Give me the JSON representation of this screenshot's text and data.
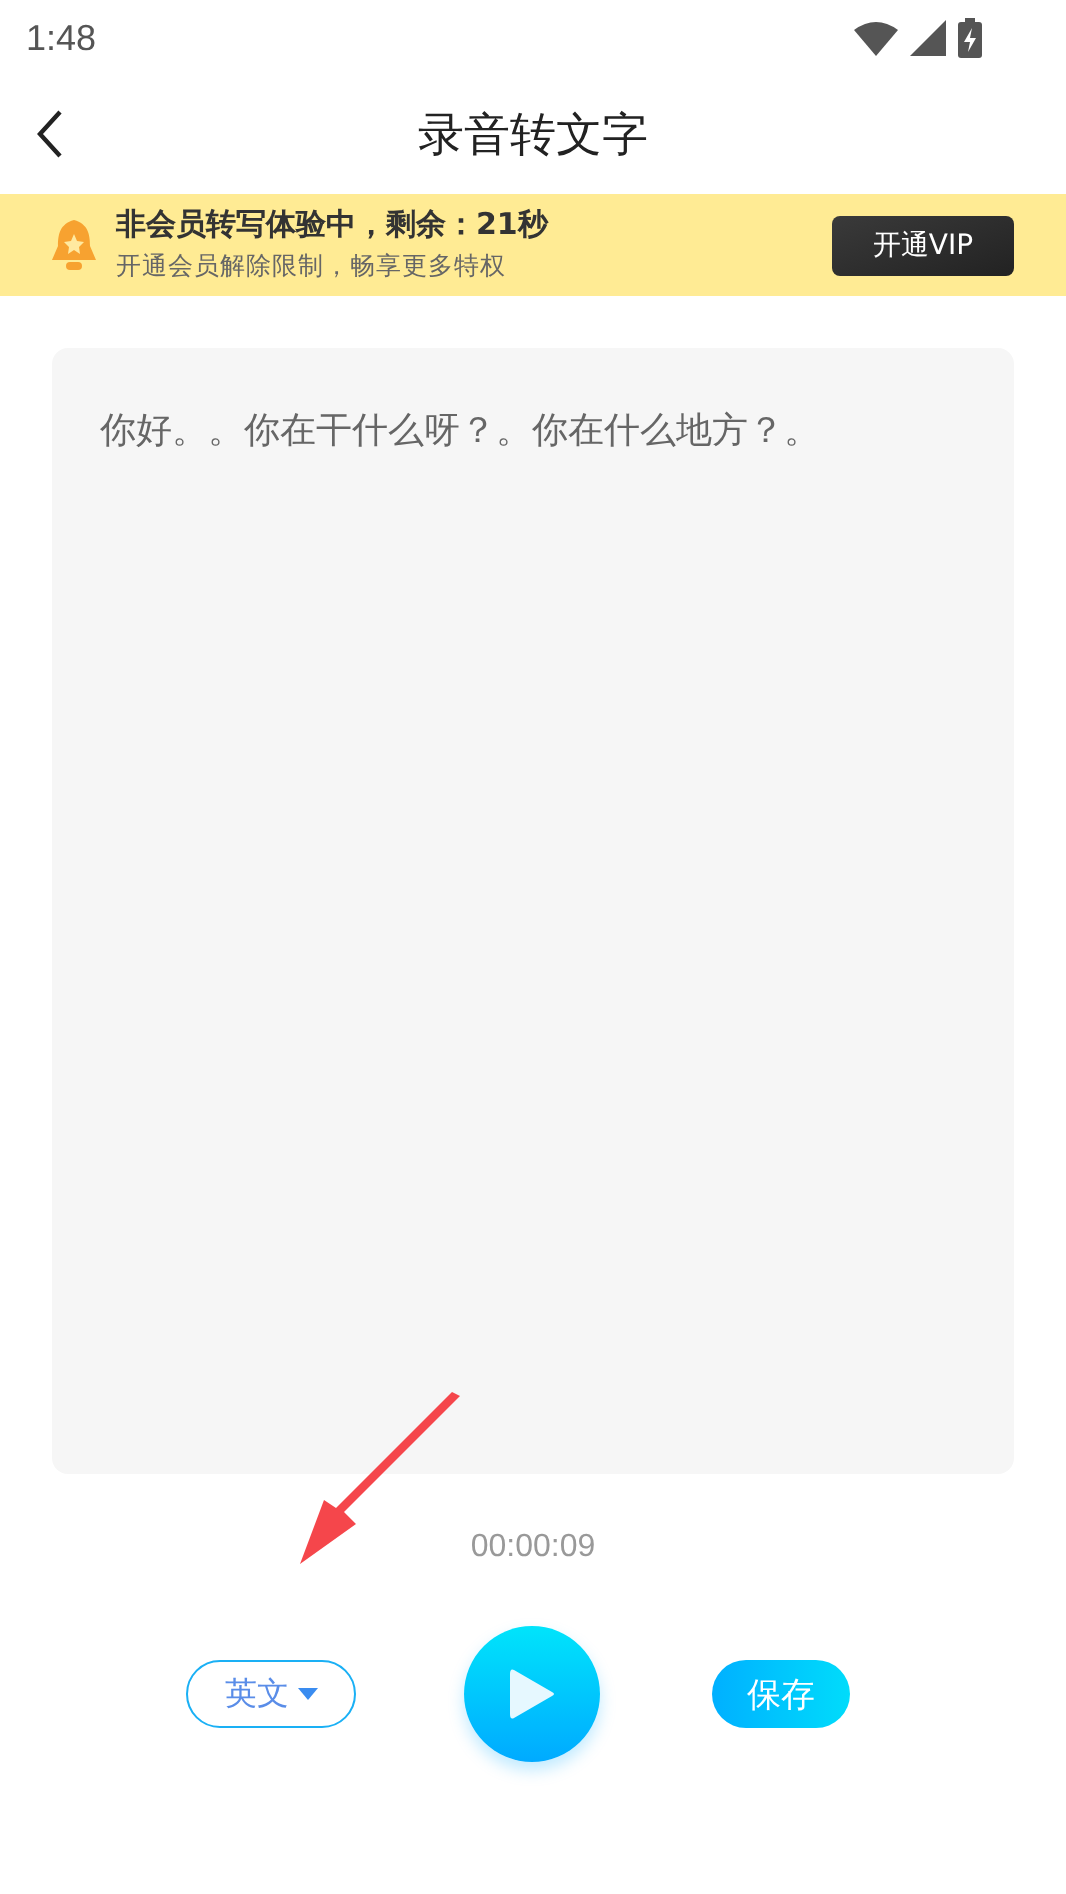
{
  "status_bar": {
    "time": "1:48"
  },
  "nav": {
    "title": "录音转文字"
  },
  "banner": {
    "title": "非会员转写体验中，剩余：21秒",
    "subtitle": "开通会员解除限制，畅享更多特权",
    "button": "开通VIP"
  },
  "transcript": {
    "text": "你好。。你在干什么呀？。你在什么地方？。"
  },
  "timer": "00:00:09",
  "controls": {
    "language": "英文",
    "save": "保存"
  }
}
